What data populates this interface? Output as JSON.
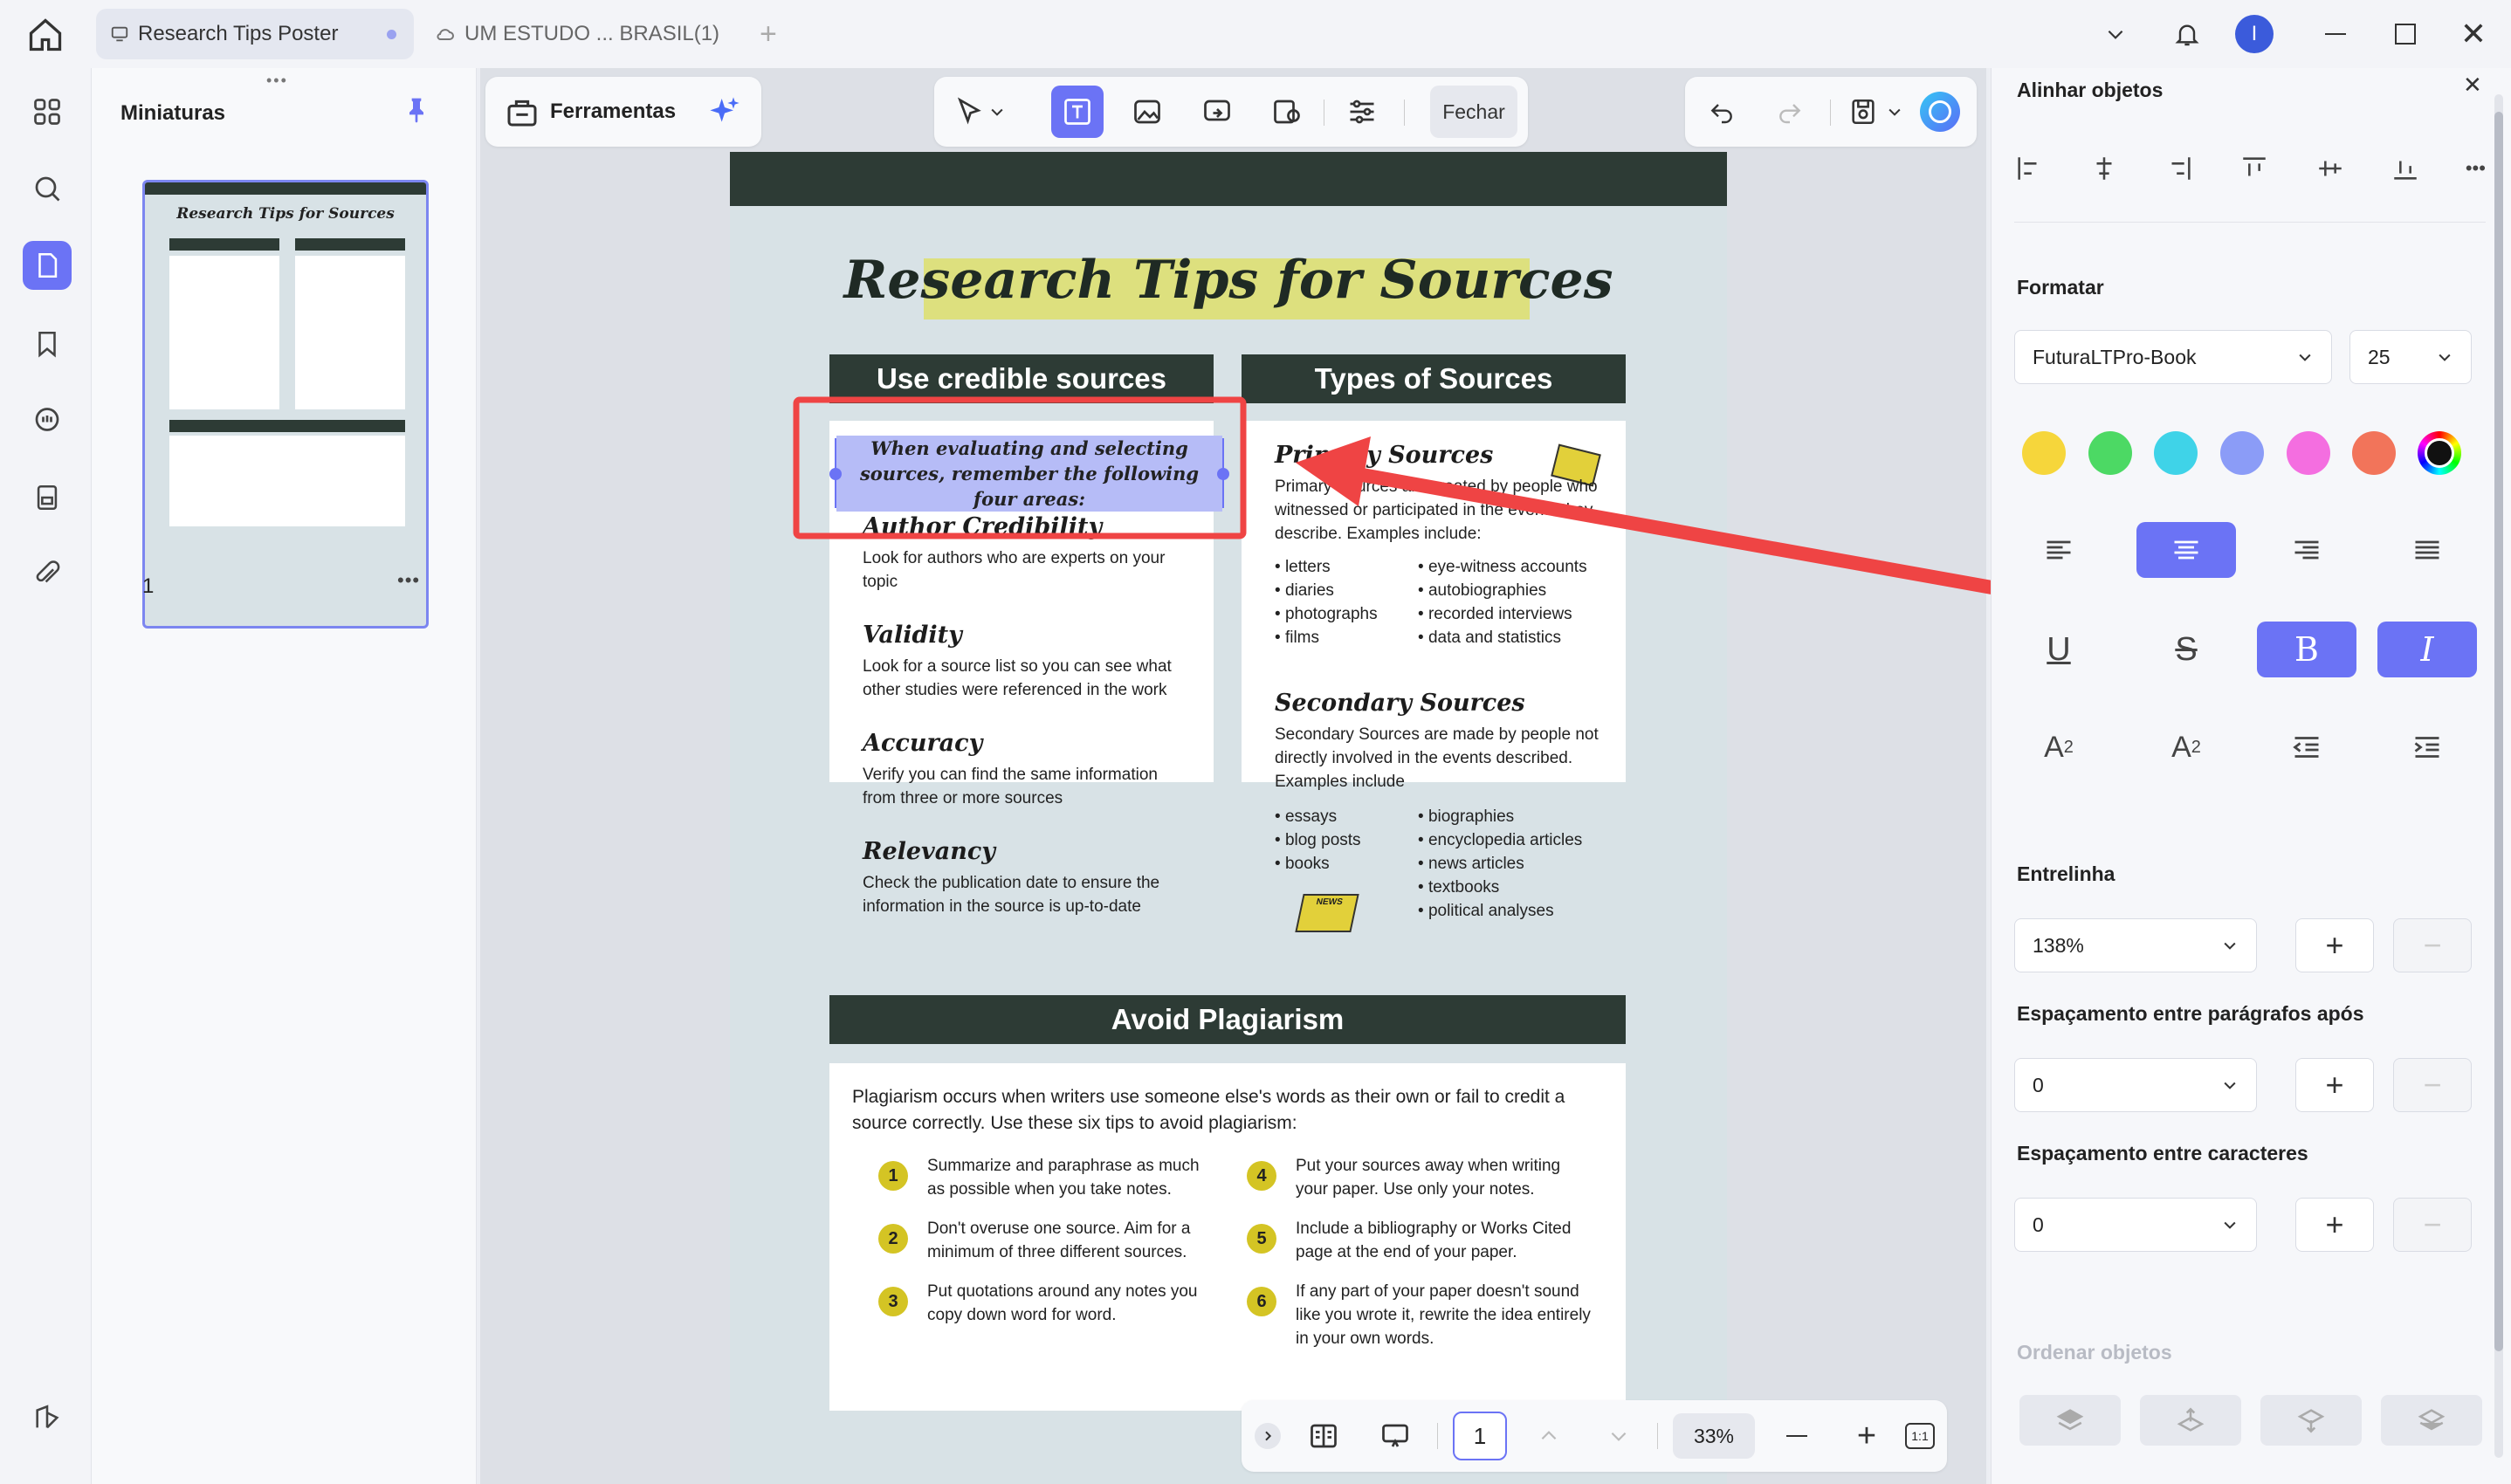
{
  "tabs": {
    "active": "Research Tips Poster",
    "second": "UM ESTUDO ... BRASIL(1)"
  },
  "user_initial": "I",
  "thumbnails": {
    "title": "Miniaturas",
    "page_label": "1"
  },
  "toolbar": {
    "tools_label": "Ferramentas",
    "close_label": "Fechar"
  },
  "poster": {
    "title": "Research Tips for Sources",
    "col1_header": "Use credible sources",
    "intro": "When evaluating and selecting sources, remember the following four areas:",
    "items": [
      {
        "h": "Author Credibility",
        "t": "Look for authors who are experts on your topic"
      },
      {
        "h": "Validity",
        "t": "Look for a source list so you can see what other studies were referenced in the work"
      },
      {
        "h": "Accuracy",
        "t": "Verify you can find the same information from three or more sources"
      },
      {
        "h": "Relevancy",
        "t": "Check the publication date to ensure the information in the source is up-to-date"
      }
    ],
    "col2_header": "Types of Sources",
    "primary_h": "Primary Sources",
    "primary_t": "Primary Sources are created by people who witnessed or participated in the events they describe. Examples include:",
    "primary_list_a": [
      "letters",
      "diaries",
      "photographs",
      "films"
    ],
    "primary_list_b": [
      "eye-witness accounts",
      "autobiographies",
      "recorded interviews",
      "data and statistics"
    ],
    "secondary_h": "Secondary Sources",
    "secondary_t": "Secondary Sources are made by people not directly involved in the events described. Examples include",
    "secondary_list_a": [
      "essays",
      "blog posts",
      "books"
    ],
    "secondary_list_b": [
      "biographies",
      "encyclopedia articles",
      "news articles",
      "textbooks",
      "political analyses"
    ],
    "news_label": "NEWS",
    "plag_header": "Avoid Plagiarism",
    "plag_intro": "Plagiarism occurs when writers use someone else's words as their own or fail to credit a source correctly. Use these six tips to avoid plagiarism:",
    "tips": [
      {
        "n": "1",
        "t": "Summarize and paraphrase as much as possible when you take notes."
      },
      {
        "n": "2",
        "t": "Don't overuse one source. Aim for a minimum of three different sources."
      },
      {
        "n": "3",
        "t": "Put quotations around any notes you copy down word for word."
      },
      {
        "n": "4",
        "t": "Put your sources away when writing your paper. Use only your notes."
      },
      {
        "n": "5",
        "t": "Include a bibliography or Works Cited page at the end of your paper."
      },
      {
        "n": "6",
        "t": "If any part of your paper doesn't sound like you wrote it, rewrite the idea entirely in your own words."
      }
    ]
  },
  "bottombar": {
    "page": "1",
    "zoom": "33%"
  },
  "panel": {
    "align_title": "Alinhar objetos",
    "format_title": "Formatar",
    "font": "FuturaLTPro-Book",
    "size": "25",
    "colors": [
      "#f6d63b",
      "#4cd964",
      "#3fd3e8",
      "#8b9cf7",
      "#f46ee0",
      "#f2745a"
    ],
    "accent": "#6b73f5",
    "line_title": "Entrelinha",
    "line_value": "138%",
    "para_title": "Espaçamento entre parágrafos após",
    "para_value": "0",
    "char_title": "Espaçamento entre caracteres",
    "char_value": "0",
    "order_title": "Ordenar objetos"
  }
}
